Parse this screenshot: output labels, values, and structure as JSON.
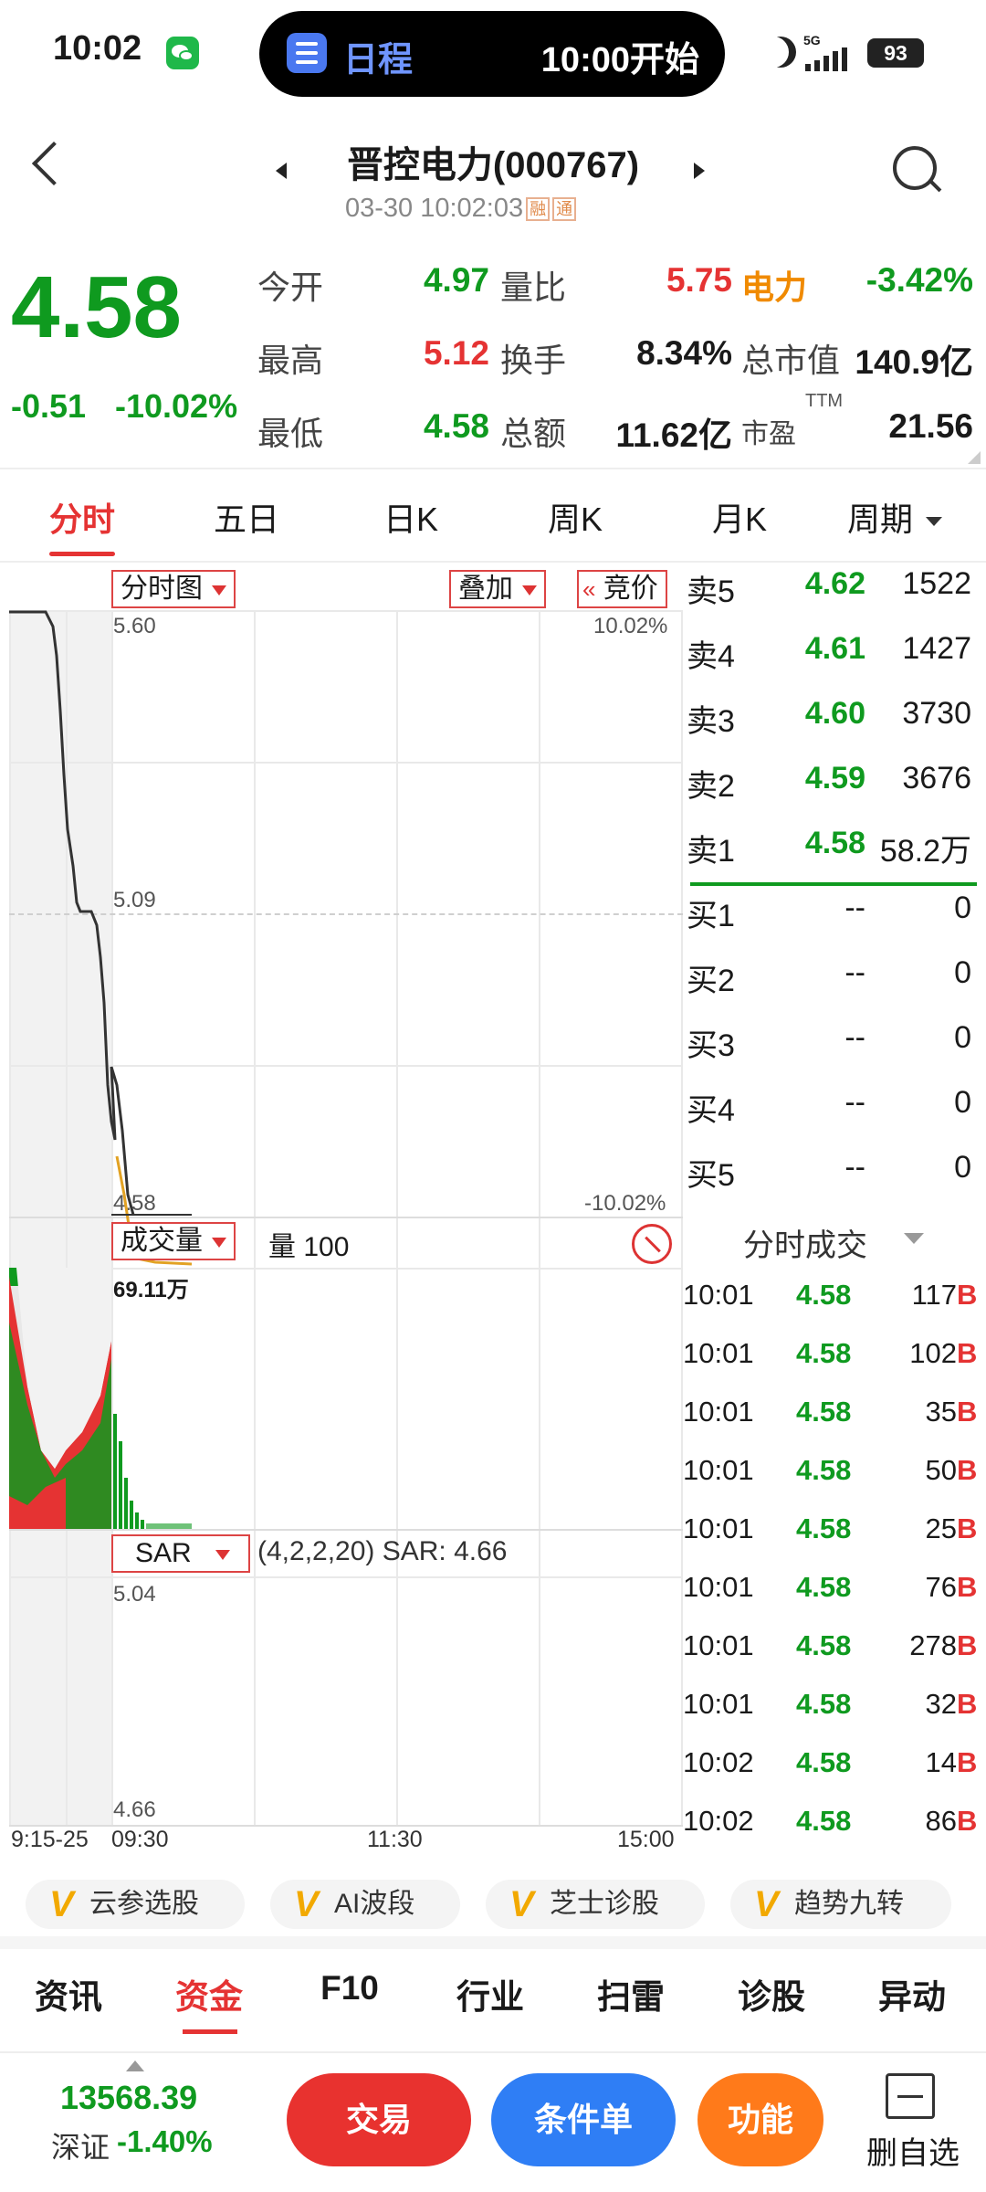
{
  "status_bar": {
    "time": "10:02",
    "notice_title": "日程",
    "notice_time": "10:00开始",
    "network": "5G",
    "battery": "93"
  },
  "header": {
    "stock_name": "晋控电力(000767)",
    "datetime": "03-30 10:02:03",
    "tag_margin": "融",
    "tag_connect": "通"
  },
  "quote": {
    "price": "4.58",
    "change": "-0.51",
    "change_pct": "-10.02%",
    "open_label": "今开",
    "open": "4.97",
    "high_label": "最高",
    "high": "5.12",
    "low_label": "最低",
    "low": "4.58",
    "vol_ratio_label": "量比",
    "vol_ratio": "5.75",
    "turnover_label": "换手",
    "turnover": "8.34%",
    "amount_label": "总额",
    "amount": "11.62亿",
    "sector_label": "电力",
    "sector_change": "-3.42%",
    "mktcap_label": "总市值",
    "mktcap": "140.9亿",
    "pe_label": "市盈",
    "pe_sup": "TTM",
    "pe": "21.56"
  },
  "tabs": [
    "分时",
    "五日",
    "日K",
    "周K",
    "月K",
    "周期"
  ],
  "chart": {
    "main_selector": "分时图",
    "overlay_selector": "叠加",
    "auction_label": "竞价",
    "price_top": "5.60",
    "price_mid": "5.09",
    "price_bottom": "4.58",
    "pct_top": "10.02%",
    "pct_bottom": "-10.02%",
    "volume_selector": "成交量",
    "volume_info": "量 100",
    "volume_max": "69.11万",
    "sar_selector": "SAR",
    "sar_info": "(4,2,2,20) SAR: 4.66",
    "sar_top": "5.04",
    "sar_bottom": "4.66",
    "time_labels": [
      "9:15-25",
      "09:30",
      "11:30",
      "15:00"
    ]
  },
  "orderbook": [
    {
      "label": "卖5",
      "price": "4.62",
      "vol": "1522"
    },
    {
      "label": "卖4",
      "price": "4.61",
      "vol": "1427"
    },
    {
      "label": "卖3",
      "price": "4.60",
      "vol": "3730"
    },
    {
      "label": "卖2",
      "price": "4.59",
      "vol": "3676"
    },
    {
      "label": "卖1",
      "price": "4.58",
      "vol": "58.2万"
    },
    {
      "label": "买1",
      "price": "--",
      "vol": "0"
    },
    {
      "label": "买2",
      "price": "--",
      "vol": "0"
    },
    {
      "label": "买3",
      "price": "--",
      "vol": "0"
    },
    {
      "label": "买4",
      "price": "--",
      "vol": "0"
    },
    {
      "label": "买5",
      "price": "--",
      "vol": "0"
    }
  ],
  "trades_title": "分时成交",
  "trades": [
    {
      "time": "10:01",
      "price": "4.58",
      "vol": "117",
      "side": "B"
    },
    {
      "time": "10:01",
      "price": "4.58",
      "vol": "102",
      "side": "B"
    },
    {
      "time": "10:01",
      "price": "4.58",
      "vol": "35",
      "side": "B"
    },
    {
      "time": "10:01",
      "price": "4.58",
      "vol": "50",
      "side": "B"
    },
    {
      "time": "10:01",
      "price": "4.58",
      "vol": "25",
      "side": "B"
    },
    {
      "time": "10:01",
      "price": "4.58",
      "vol": "76",
      "side": "B"
    },
    {
      "time": "10:01",
      "price": "4.58",
      "vol": "278",
      "side": "B"
    },
    {
      "time": "10:01",
      "price": "4.58",
      "vol": "32",
      "side": "B"
    },
    {
      "time": "10:02",
      "price": "4.58",
      "vol": "14",
      "side": "B"
    },
    {
      "time": "10:02",
      "price": "4.58",
      "vol": "86",
      "side": "B"
    }
  ],
  "tools": [
    "云参选股",
    "AI波段",
    "芝士诊股",
    "趋势九转"
  ],
  "footer_tabs": [
    "资讯",
    "资金",
    "F10",
    "行业",
    "扫雷",
    "诊股",
    "异动"
  ],
  "footer_active": "资金",
  "index": {
    "value": "13568.39",
    "name": "深证",
    "change_pct": "-1.40%"
  },
  "buttons": {
    "trade": "交易",
    "condition": "条件单",
    "function": "功能",
    "remove_watch": "删自选"
  },
  "colors": {
    "up": "#e53333",
    "down": "#0f9a1f",
    "accent_orange": "#f08a00"
  }
}
